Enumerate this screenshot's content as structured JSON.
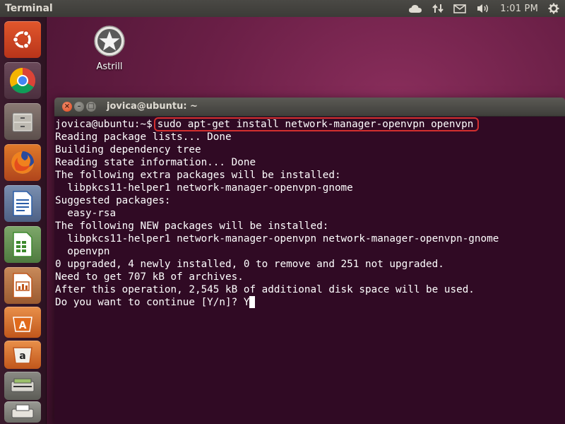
{
  "top_panel": {
    "title": "Terminal",
    "clock": "1:01 PM",
    "indicators": [
      "cloud-icon",
      "network-icon",
      "mail-icon",
      "volume-icon",
      "gear-icon"
    ]
  },
  "launcher": {
    "items": [
      "ubuntu-dash-icon",
      "chrome-icon",
      "files-icon",
      "firefox-icon",
      "writer-icon",
      "calc-icon",
      "impress-icon",
      "software-center-icon",
      "amazon-icon",
      "scanner-icon",
      "printer-icon"
    ]
  },
  "desktop": {
    "icon_label": "Astrill"
  },
  "terminal": {
    "window_title": "jovica@ubuntu: ~",
    "prompt": "jovica@ubuntu:~$",
    "command": "sudo apt-get install network-manager-openvpn openvpn",
    "output": [
      "Reading package lists... Done",
      "Building dependency tree",
      "Reading state information... Done",
      "The following extra packages will be installed:",
      "  libpkcs11-helper1 network-manager-openvpn-gnome",
      "Suggested packages:",
      "  easy-rsa",
      "The following NEW packages will be installed:",
      "  libpkcs11-helper1 network-manager-openvpn network-manager-openvpn-gnome",
      "  openvpn",
      "0 upgraded, 4 newly installed, 0 to remove and 251 not upgraded.",
      "Need to get 707 kB of archives.",
      "After this operation, 2,545 kB of additional disk space will be used."
    ],
    "last_line": "Do you want to continue [Y/n]? Y"
  },
  "colors": {
    "terminal_bg": "#300a24",
    "highlight_border": "#d32f2f",
    "panel_bg": "#3c3b37"
  }
}
